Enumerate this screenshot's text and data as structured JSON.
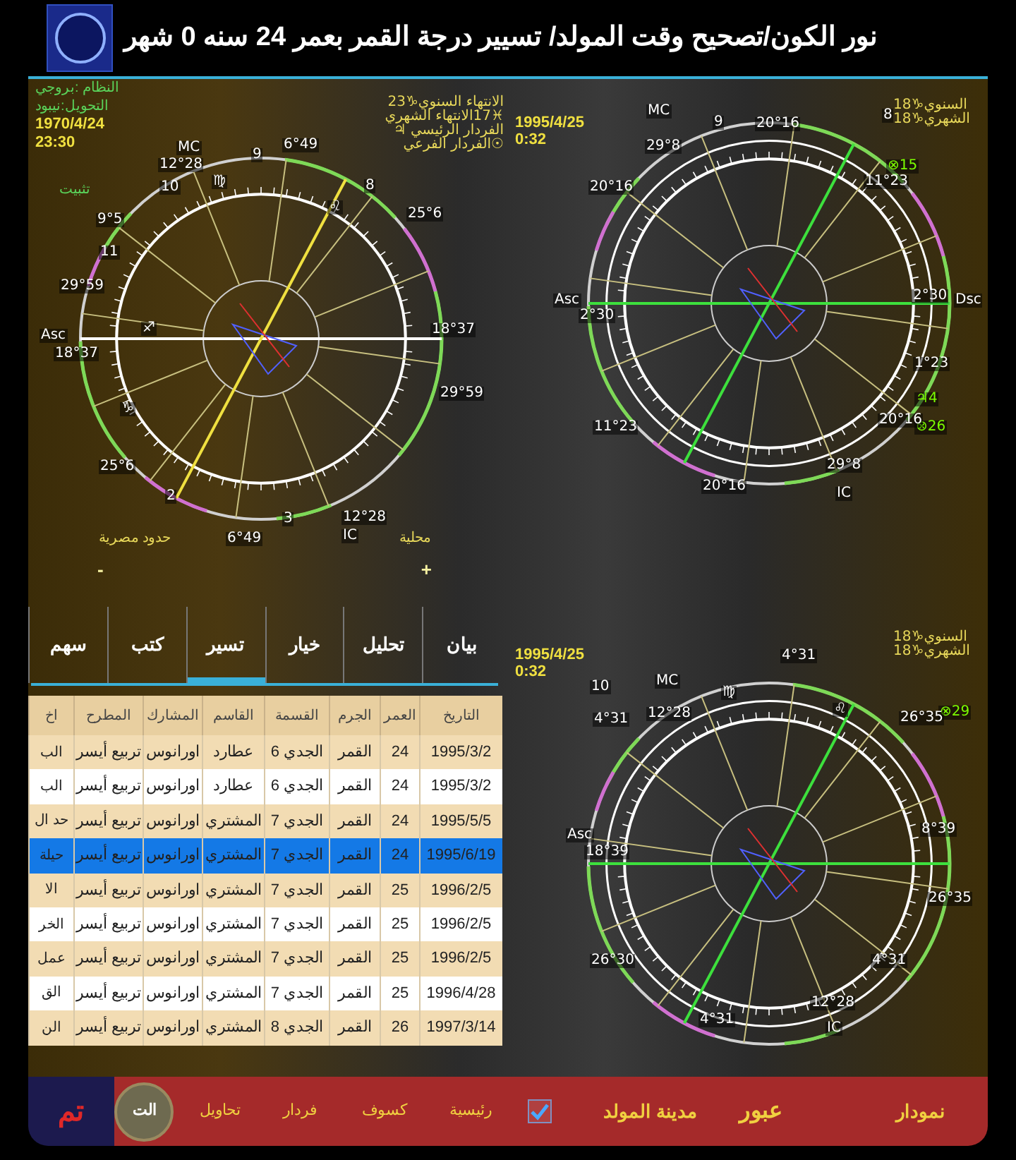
{
  "header": {
    "title": "نور الكون/تصحيح وقت المولد/  تسيير درجة القمر بعمر 24 سنه 0 شهر"
  },
  "natal_chart": {
    "system": "النظام :بروجي",
    "conversion": "التحويل:نيبود",
    "date": "1970/4/24",
    "time": "23:30",
    "fix_label": "تثبيت",
    "labels": [
      {
        "kind": "house",
        "text": "6°49"
      },
      {
        "kind": "house",
        "text": "9"
      },
      {
        "kind": "house",
        "text": "MC"
      },
      {
        "kind": "house",
        "text": "12°28"
      },
      {
        "kind": "house",
        "text": "8"
      },
      {
        "kind": "house",
        "text": "♍"
      },
      {
        "kind": "house",
        "text": "10"
      },
      {
        "kind": "house",
        "text": "25°6"
      },
      {
        "kind": "house",
        "text": "♌"
      },
      {
        "kind": "house",
        "text": "9°5"
      },
      {
        "kind": "house",
        "text": "11"
      },
      {
        "kind": "house",
        "text": "29°59"
      },
      {
        "kind": "house",
        "text": "18°37"
      },
      {
        "kind": "house",
        "text": "♐"
      },
      {
        "kind": "house",
        "text": "Asc"
      },
      {
        "kind": "house",
        "text": "18°37"
      },
      {
        "kind": "house",
        "text": "29°59"
      },
      {
        "kind": "house",
        "text": "♑"
      },
      {
        "kind": "house",
        "text": "25°6"
      },
      {
        "kind": "house",
        "text": "2"
      },
      {
        "kind": "house",
        "text": "12°28"
      },
      {
        "kind": "house",
        "text": "3"
      },
      {
        "kind": "house",
        "text": "IC"
      },
      {
        "kind": "house",
        "text": "6°49"
      }
    ]
  },
  "progression_chart": {
    "notes": [
      "الانتهاء السنوي♑23",
      "♓17الانتهاء الشهري",
      "الفردار الرئيسي ♃",
      "☉الفردار الفرعي"
    ],
    "date": "1995/4/25",
    "time": "0:32",
    "annual": "السنوي♑18",
    "monthly": "الشهري♑18",
    "labels": [
      {
        "kind": "house",
        "text": "8"
      },
      {
        "kind": "house",
        "text": "20°16"
      },
      {
        "kind": "house",
        "text": "9"
      },
      {
        "kind": "house",
        "text": "MC"
      },
      {
        "kind": "house",
        "text": "29°8"
      },
      {
        "kind": "point",
        "text": "⊗15"
      },
      {
        "kind": "house",
        "text": "11°23"
      },
      {
        "kind": "house",
        "text": "20°16"
      },
      {
        "kind": "house",
        "text": "Dsc"
      },
      {
        "kind": "house",
        "text": "2°30"
      },
      {
        "kind": "house",
        "text": "Asc"
      },
      {
        "kind": "house",
        "text": "2°30"
      },
      {
        "kind": "house",
        "text": "1°23"
      },
      {
        "kind": "point",
        "text": "♃4"
      },
      {
        "kind": "point",
        "text": "⊗26"
      },
      {
        "kind": "house",
        "text": "20°16"
      },
      {
        "kind": "house",
        "text": "11°23"
      },
      {
        "kind": "house",
        "text": "29°8"
      },
      {
        "kind": "house",
        "text": "IC"
      },
      {
        "kind": "house",
        "text": "20°16"
      }
    ]
  },
  "transit_chart": {
    "date": "1995/4/25",
    "time": "0:32",
    "annual": "السنوي♑18",
    "monthly": "الشهري♑18",
    "labels": [
      {
        "kind": "house",
        "text": "4°31"
      },
      {
        "kind": "house",
        "text": "♍"
      },
      {
        "kind": "house",
        "text": "MC"
      },
      {
        "kind": "house",
        "text": "10"
      },
      {
        "kind": "point",
        "text": "⊗29"
      },
      {
        "kind": "house",
        "text": "26°35"
      },
      {
        "kind": "house",
        "text": "♌"
      },
      {
        "kind": "house",
        "text": "12°28"
      },
      {
        "kind": "house",
        "text": "4°31"
      },
      {
        "kind": "house",
        "text": "8°39"
      },
      {
        "kind": "house",
        "text": "Asc"
      },
      {
        "kind": "house",
        "text": "18°39"
      },
      {
        "kind": "house",
        "text": "26°35"
      },
      {
        "kind": "house",
        "text": "4°31"
      },
      {
        "kind": "house",
        "text": "26°30"
      },
      {
        "kind": "house",
        "text": "12°28"
      },
      {
        "kind": "house",
        "text": "IC"
      },
      {
        "kind": "house",
        "text": "4°31"
      }
    ]
  },
  "controls": {
    "left_label": "حدود مصرية",
    "right_label": "محلية",
    "minus": "-",
    "plus": "+"
  },
  "tabs": [
    {
      "label": "بيان",
      "selected": false
    },
    {
      "label": "تحليل",
      "selected": false
    },
    {
      "label": "خيار",
      "selected": false
    },
    {
      "label": "تسير",
      "selected": true
    },
    {
      "label": "كتب",
      "selected": false
    },
    {
      "label": "سهم",
      "selected": false
    }
  ],
  "table": {
    "columns": [
      "التاريخ",
      "العمر",
      "الجرم",
      "القسمة",
      "القاسم",
      "المشارك",
      "المطرح",
      "اخ"
    ],
    "rows": [
      {
        "cells": [
          "1995/3/2",
          "24",
          "القمر",
          "الجدي 6",
          "عطارد",
          "اورانوس",
          "تربيع أيسر",
          "الب"
        ],
        "selected": false
      },
      {
        "cells": [
          "1995/3/2",
          "24",
          "القمر",
          "الجدي 6",
          "عطارد",
          "اورانوس",
          "تربيع أيسر",
          "الب"
        ],
        "selected": false
      },
      {
        "cells": [
          "1995/5/5",
          "24",
          "القمر",
          "الجدي 7",
          "المشتري",
          "اورانوس",
          "تربيع أيسر",
          "حد ال"
        ],
        "selected": false
      },
      {
        "cells": [
          "1995/6/19",
          "24",
          "القمر",
          "الجدي 7",
          "المشتري",
          "اورانوس",
          "تربيع أيسر",
          "حيلة"
        ],
        "selected": true
      },
      {
        "cells": [
          "1996/2/5",
          "25",
          "القمر",
          "الجدي 7",
          "المشتري",
          "اورانوس",
          "تربيع أيسر",
          "الا"
        ],
        "selected": false
      },
      {
        "cells": [
          "1996/2/5",
          "25",
          "القمر",
          "الجدي 7",
          "المشتري",
          "اورانوس",
          "تربيع أيسر",
          "الخر"
        ],
        "selected": false
      },
      {
        "cells": [
          "1996/2/5",
          "25",
          "القمر",
          "الجدي 7",
          "المشتري",
          "اورانوس",
          "تربيع أيسر",
          "عمل"
        ],
        "selected": false
      },
      {
        "cells": [
          "1996/4/28",
          "25",
          "القمر",
          "الجدي 7",
          "المشتري",
          "اورانوس",
          "تربيع أيسر",
          "الق"
        ],
        "selected": false
      },
      {
        "cells": [
          "1997/3/14",
          "26",
          "القمر",
          "الجدي 8",
          "المشتري",
          "اورانوس",
          "تربيع أيسر",
          "الن"
        ],
        "selected": false
      }
    ]
  },
  "bottom_bar": {
    "done": "تم",
    "emblem": "الت",
    "items": [
      {
        "kind": "major",
        "label": "نمودار"
      },
      {
        "kind": "big",
        "label": "عبور"
      },
      {
        "kind": "major",
        "label": "مدينة المولد"
      },
      {
        "kind": "checkbox",
        "checked": true
      },
      {
        "kind": "link",
        "label": "رئيسية"
      },
      {
        "kind": "link",
        "label": "كسوف"
      },
      {
        "kind": "link",
        "label": "فردار"
      },
      {
        "kind": "link",
        "label": "تحاويل"
      }
    ]
  }
}
